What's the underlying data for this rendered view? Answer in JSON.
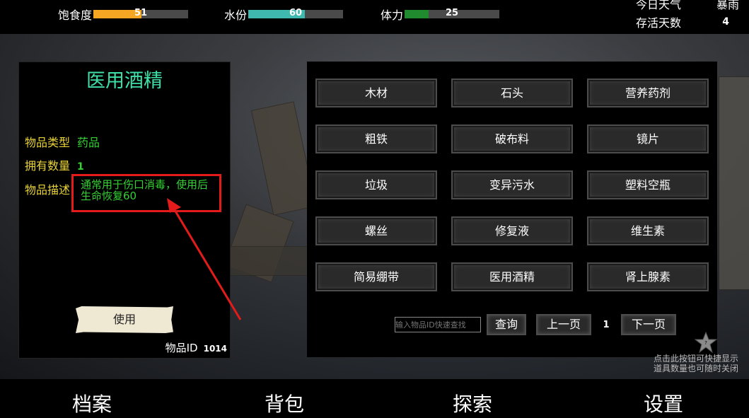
{
  "stats": [
    {
      "label": "饱食度",
      "value": "51",
      "fraction": 0.51,
      "color": "#f5a623"
    },
    {
      "label": "水份",
      "value": "60",
      "fraction": 0.6,
      "color": "#3fb8b0"
    },
    {
      "label": "体力",
      "value": "25",
      "fraction": 0.25,
      "color": "#1f8a2e"
    }
  ],
  "weather": {
    "label": "今日天气",
    "value": "暴雨"
  },
  "days": {
    "label": "存活天数",
    "value": "4"
  },
  "detail": {
    "title": "医用酒精",
    "type_label": "物品类型",
    "type_value": "药品",
    "count_label": "拥有数量",
    "count_value": "1",
    "desc_label": "物品描述",
    "desc_value": "通常用于伤口消毒，使用后生命恢复60",
    "use_label": "使用",
    "id_label": "物品ID",
    "id_value": "1014"
  },
  "items": [
    "木材",
    "石头",
    "营养药剂",
    "粗铁",
    "破布料",
    "镜片",
    "垃圾",
    "变异污水",
    "塑料空瓶",
    "螺丝",
    "修复液",
    "维生素",
    "简易绷带",
    "医用酒精",
    "肾上腺素"
  ],
  "search": {
    "placeholder": "输入物品ID快速查找",
    "query_label": "查询",
    "prev_label": "上一页",
    "page": "1",
    "next_label": "下一页"
  },
  "hint": {
    "line1": "点击此按钮可快捷显示",
    "line2": "道具数量也可随时关闭"
  },
  "nav": {
    "archive": "档案",
    "bag": "背包",
    "explore": "探索",
    "settings": "设置"
  },
  "colors": {
    "title": "#3fe0a8",
    "label": "#e8d23a",
    "value": "#34d034",
    "highlight": "#e51b1b"
  }
}
